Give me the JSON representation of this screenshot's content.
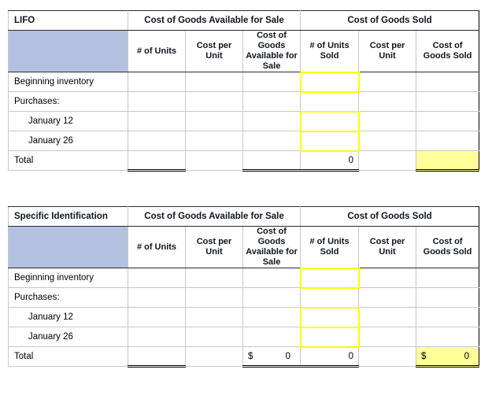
{
  "columns": {
    "group_available": "Cost of Goods Available for Sale",
    "group_sold": "Cost of Goods Sold",
    "units_available": "# of Units",
    "cost_per_unit_available": "Cost per Unit",
    "cost_of_goods_available": "Cost of Goods Available for Sale",
    "units_sold": "# of Units Sold",
    "cost_per_unit_sold": "Cost per Unit",
    "cost_of_goods_sold": "Cost of Goods Sold"
  },
  "colors": {
    "header_title_blue": "#88a0d4",
    "header_sub_blue": "#b2c1e0",
    "input_outline_yellow": "#ffff00",
    "result_fill_yellow": "#ffff99"
  },
  "tables": [
    {
      "title": "LIFO",
      "rows": [
        {
          "label": "Beginning inventory",
          "indent": false,
          "units_available": "",
          "cost_per_unit_available": "",
          "cost_of_goods_available": "",
          "units_sold": "",
          "cost_per_unit_sold": "",
          "cost_of_goods_sold": ""
        },
        {
          "label": "Purchases:",
          "indent": false,
          "units_available": "",
          "cost_per_unit_available": "",
          "cost_of_goods_available": "",
          "units_sold": "",
          "cost_per_unit_sold": "",
          "cost_of_goods_sold": ""
        },
        {
          "label": "January 12",
          "indent": true,
          "units_available": "",
          "cost_per_unit_available": "",
          "cost_of_goods_available": "",
          "units_sold": "",
          "cost_per_unit_sold": "",
          "cost_of_goods_sold": ""
        },
        {
          "label": "January 26",
          "indent": true,
          "units_available": "",
          "cost_per_unit_available": "",
          "cost_of_goods_available": "",
          "units_sold": "",
          "cost_per_unit_sold": "",
          "cost_of_goods_sold": ""
        }
      ],
      "total": {
        "label": "Total",
        "units_available": "",
        "cost_per_unit_available": "",
        "cost_of_goods_available_symbol": "",
        "cost_of_goods_available_value": "",
        "units_sold": "0",
        "cost_per_unit_sold": "",
        "cost_of_goods_sold_symbol": "",
        "cost_of_goods_sold_value": ""
      }
    },
    {
      "title": "Specific Identification",
      "rows": [
        {
          "label": "Beginning inventory",
          "indent": false,
          "units_available": "",
          "cost_per_unit_available": "",
          "cost_of_goods_available": "",
          "units_sold": "",
          "cost_per_unit_sold": "",
          "cost_of_goods_sold": ""
        },
        {
          "label": "Purchases:",
          "indent": false,
          "units_available": "",
          "cost_per_unit_available": "",
          "cost_of_goods_available": "",
          "units_sold": "",
          "cost_per_unit_sold": "",
          "cost_of_goods_sold": ""
        },
        {
          "label": "January 12",
          "indent": true,
          "units_available": "",
          "cost_per_unit_available": "",
          "cost_of_goods_available": "",
          "units_sold": "",
          "cost_per_unit_sold": "",
          "cost_of_goods_sold": ""
        },
        {
          "label": "January 26",
          "indent": true,
          "units_available": "",
          "cost_per_unit_available": "",
          "cost_of_goods_available": "",
          "units_sold": "",
          "cost_per_unit_sold": "",
          "cost_of_goods_sold": ""
        }
      ],
      "total": {
        "label": "Total",
        "units_available": "",
        "cost_per_unit_available": "",
        "cost_of_goods_available_symbol": "$",
        "cost_of_goods_available_value": "0",
        "units_sold": "0",
        "cost_per_unit_sold": "",
        "cost_of_goods_sold_symbol": "$",
        "cost_of_goods_sold_value": "0"
      }
    }
  ]
}
